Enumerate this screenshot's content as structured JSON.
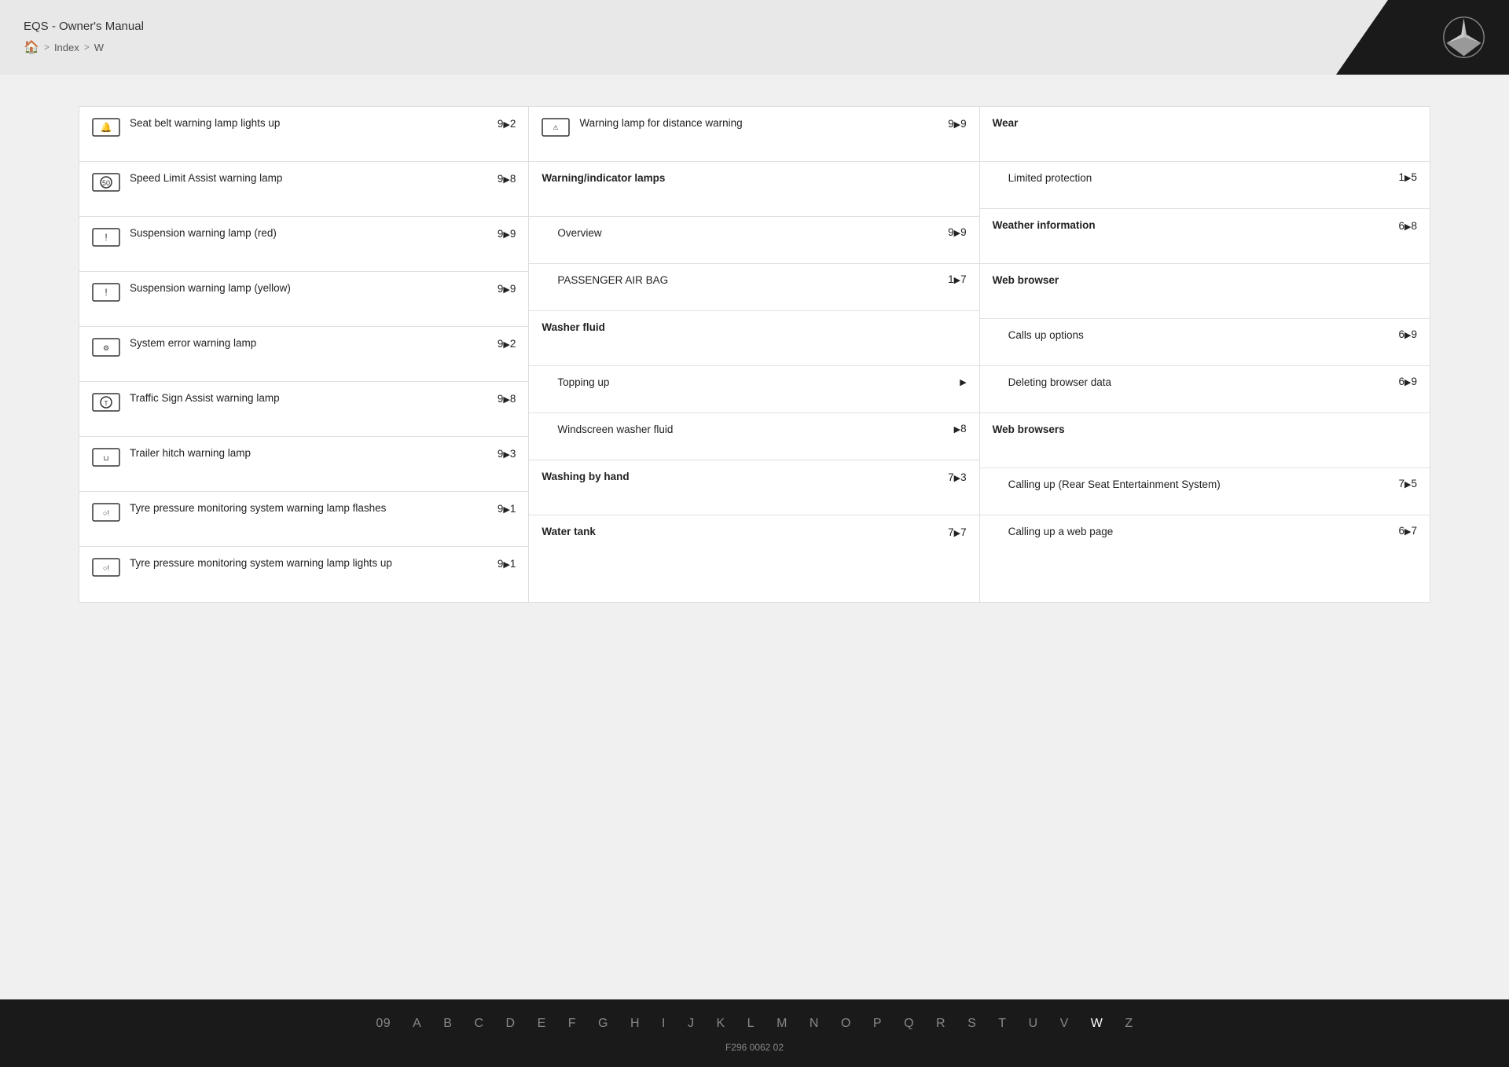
{
  "header": {
    "title": "EQS - Owner's Manual",
    "breadcrumb": [
      "🏠",
      ">",
      "Index",
      ">",
      "W"
    ]
  },
  "columns": [
    {
      "entries": [
        {
          "type": "icon-entry",
          "icon": "seatbelt",
          "text": "Seat belt warning lamp lights up",
          "page": "9▶2"
        },
        {
          "type": "icon-entry",
          "icon": "speedlimit",
          "text": "Speed Limit Assist warning lamp",
          "page": "9▶8"
        },
        {
          "type": "icon-entry",
          "icon": "suspension",
          "text": "Suspension warning lamp (red)",
          "page": "9▶9"
        },
        {
          "type": "icon-entry",
          "icon": "suspension2",
          "text": "Suspension warning lamp (yellow)",
          "page": "9▶9"
        },
        {
          "type": "icon-entry",
          "icon": "systemerror",
          "text": "System error warning lamp",
          "page": "9▶2"
        },
        {
          "type": "icon-entry",
          "icon": "trafficsign",
          "text": "Traffic Sign Assist warning lamp",
          "page": "9▶8"
        },
        {
          "type": "icon-entry",
          "icon": "trailerhitch",
          "text": "Trailer hitch warning lamp",
          "page": "9▶3"
        },
        {
          "type": "icon-entry",
          "icon": "tpmsflash",
          "text": "Tyre pressure monitoring system warning lamp flashes",
          "page": "9▶1"
        },
        {
          "type": "icon-entry",
          "icon": "tpmslight",
          "text": "Tyre pressure monitoring system warning lamp lights up",
          "page": "9▶1"
        }
      ]
    },
    {
      "entries": [
        {
          "type": "icon-entry",
          "icon": "distancewarning",
          "text": "Warning lamp for distance warning",
          "page": "9▶9"
        },
        {
          "type": "header-entry",
          "text": "Warning/indicator lamps"
        },
        {
          "type": "sub-entry",
          "text": "Overview",
          "page": "9▶9"
        },
        {
          "type": "sub-entry",
          "text": "PASSENGER AIR BAG",
          "page": "1▶7"
        },
        {
          "type": "header-entry",
          "text": "Washer fluid"
        },
        {
          "type": "sub-entry",
          "text": "Topping up",
          "page": "▶"
        },
        {
          "type": "sub-entry",
          "text": "Windscreen washer fluid",
          "page": "▶8"
        },
        {
          "type": "header-entry",
          "text": "Washing by hand",
          "page": "7▶3"
        },
        {
          "type": "header-entry",
          "text": "Water tank",
          "page": "7▶7"
        }
      ]
    },
    {
      "entries": [
        {
          "type": "header-entry",
          "text": "Wear"
        },
        {
          "type": "sub-entry",
          "text": "Limited protection",
          "page": "1▶5"
        },
        {
          "type": "plain-entry",
          "text": "Weather information",
          "page": "6▶8",
          "bold": true
        },
        {
          "type": "header-entry",
          "text": "Web browser"
        },
        {
          "type": "sub-entry",
          "text": "Calls up options",
          "page": "6▶9"
        },
        {
          "type": "sub-entry",
          "text": "Deleting browser data",
          "page": "6▶9"
        },
        {
          "type": "header-entry",
          "text": "Web browsers"
        },
        {
          "type": "sub-entry",
          "text": "Calling up (Rear Seat Entertainment System)",
          "page": "7▶5"
        },
        {
          "type": "sub-entry",
          "text": "Calling up a web page",
          "page": "6▶7"
        }
      ]
    }
  ],
  "footer": {
    "alpha": [
      "09",
      "A",
      "B",
      "C",
      "D",
      "E",
      "F",
      "G",
      "H",
      "I",
      "J",
      "K",
      "L",
      "M",
      "N",
      "O",
      "P",
      "Q",
      "R",
      "S",
      "T",
      "U",
      "V",
      "W",
      "Z"
    ],
    "active": "W",
    "code": "F296 0062 02"
  }
}
